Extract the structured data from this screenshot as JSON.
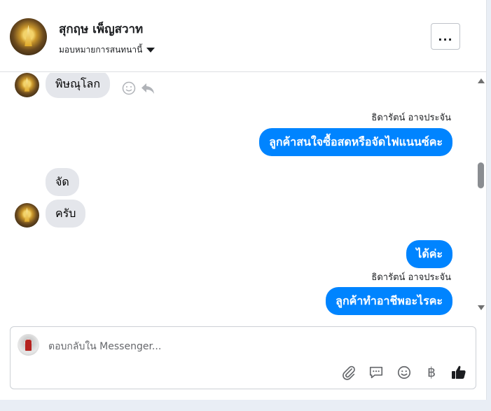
{
  "header": {
    "contact_name": "สุกฤษ เพ็ญสวาท",
    "assign_label": "มอบหมายการสนทนานี้",
    "more_label": "..."
  },
  "thread": {
    "messages": [
      {
        "direction": "in",
        "text": "พิษณุโลก"
      },
      {
        "direction": "out",
        "sender": "ธิดารัตน์ อาจประจัน",
        "text": "ลูกค้าสนใจซื้อสดหรือจัดไฟแนนซ์คะ"
      },
      {
        "direction": "in",
        "text": "จัด"
      },
      {
        "direction": "in",
        "text": "ครับ"
      },
      {
        "direction": "out",
        "text": "ได้ค่ะ"
      },
      {
        "direction": "out",
        "sender": "ธิดารัตน์ อาจประจัน",
        "text": "ลูกค้าทำอาชีพอะไรคะ"
      }
    ]
  },
  "composer": {
    "placeholder": "ตอบกลับใน Messenger...",
    "currency_symbol": "฿"
  },
  "colors": {
    "outgoing_bubble": "#0084ff",
    "incoming_bubble": "#e4e6eb"
  },
  "icons": [
    "more-icon",
    "caret-down-icon",
    "emoji-react-icon",
    "reply-icon",
    "attach-icon",
    "saved-reply-icon",
    "emoji-icon",
    "currency-icon",
    "like-icon"
  ]
}
